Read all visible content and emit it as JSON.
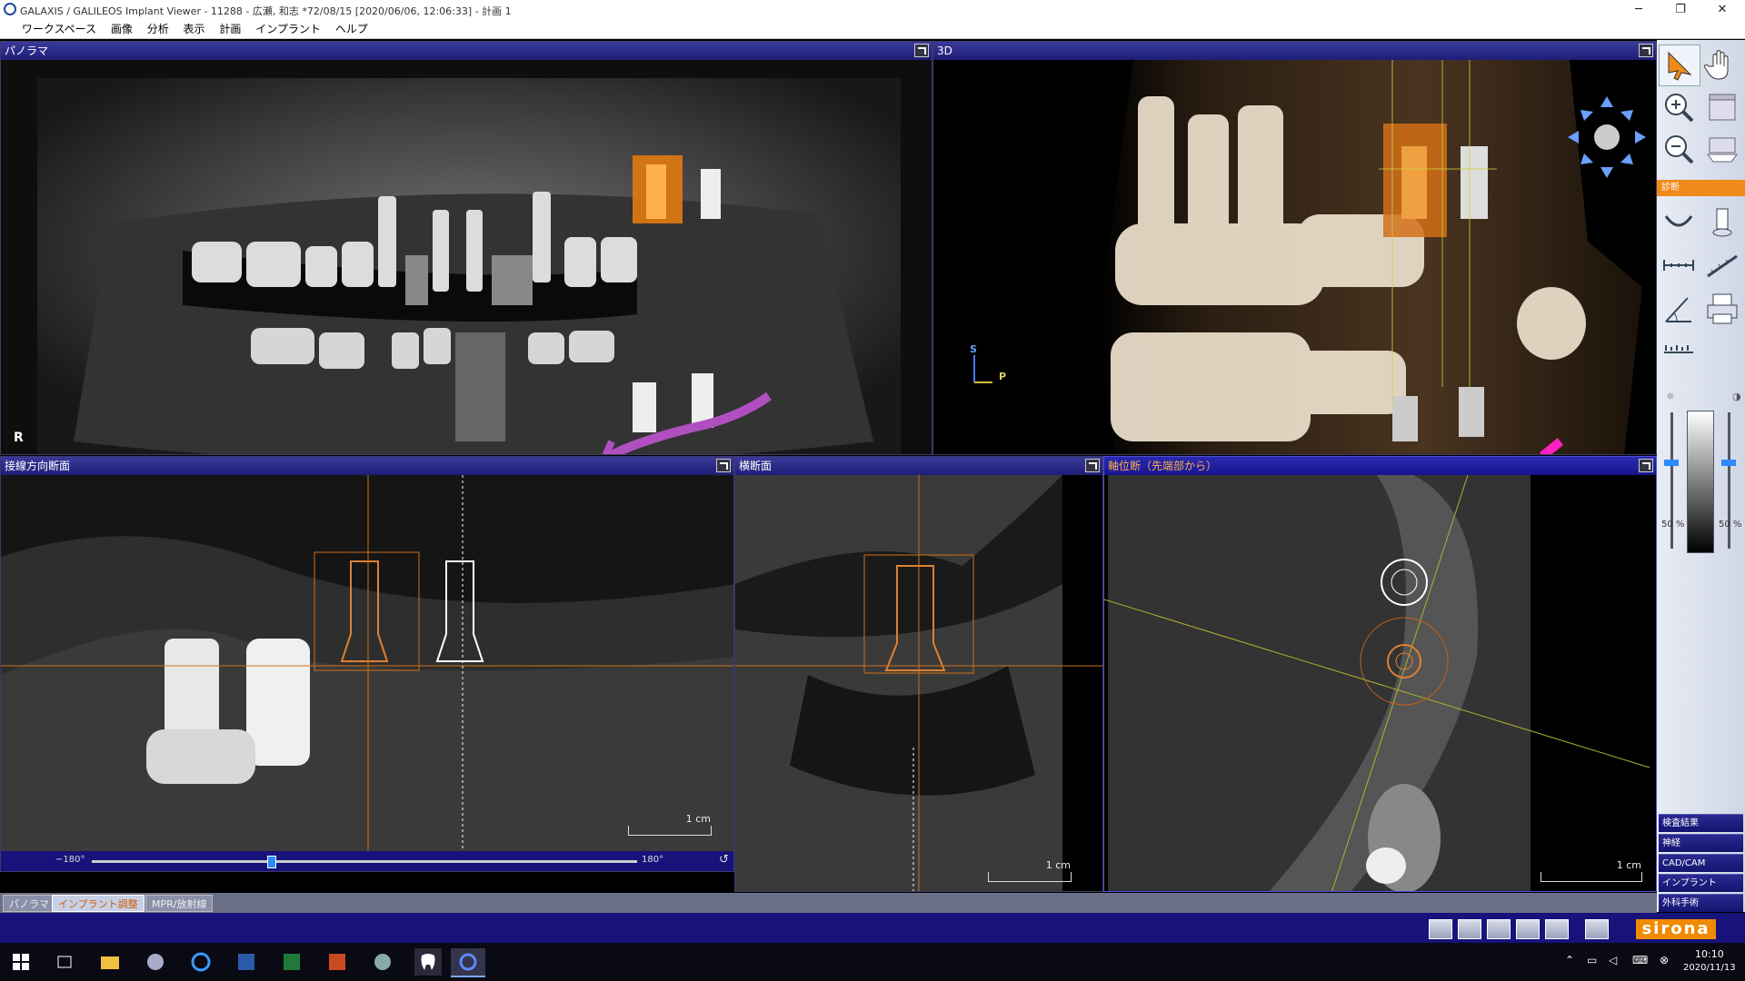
{
  "window": {
    "title": "GALAXIS / GALILEOS Implant Viewer - 11288 - 広瀬, 和志 *72/08/15 [2020/06/06, 12:06:33] - 計画 1",
    "minimize": "─",
    "restore": "❐",
    "close": "✕"
  },
  "menu": [
    "ワークスペース",
    "画像",
    "分析",
    "表示",
    "計画",
    "インプラント",
    "ヘルプ"
  ],
  "panels": {
    "panorama": {
      "title": "パノラマ",
      "marker": "R"
    },
    "view3d": {
      "title": "3D",
      "axis_s": "S",
      "axis_p": "P"
    },
    "tangential": {
      "title": "接線方向断面",
      "scale": "1 cm",
      "slider_min": "−180°",
      "slider_max": "180°",
      "slider_value_fraction": 0.33
    },
    "transversal": {
      "title": "横断面",
      "scale": "1 cm"
    },
    "axial": {
      "title": "軸位断（先端部から）",
      "scale": "1 cm"
    }
  },
  "right_toolbar": {
    "section_label": "診断",
    "brightness_label": "50 %",
    "contrast_label": "50 %",
    "side_tabs": [
      "検査結果",
      "神経",
      "CAD/CAM",
      "インプラント",
      "外科手術"
    ]
  },
  "bottom_tabs": [
    {
      "label": "パノラマ",
      "active": false
    },
    {
      "label": "インプラント調整",
      "active": true
    },
    {
      "label": "MPR/放射線",
      "active": false
    }
  ],
  "brand": "sirona",
  "taskbar": {
    "time": "10:10",
    "date": "2020/11/13"
  },
  "colors": {
    "header": "#1e1e78",
    "accent_orange": "#ff8a1a",
    "brand_orange": "#f08a00"
  }
}
